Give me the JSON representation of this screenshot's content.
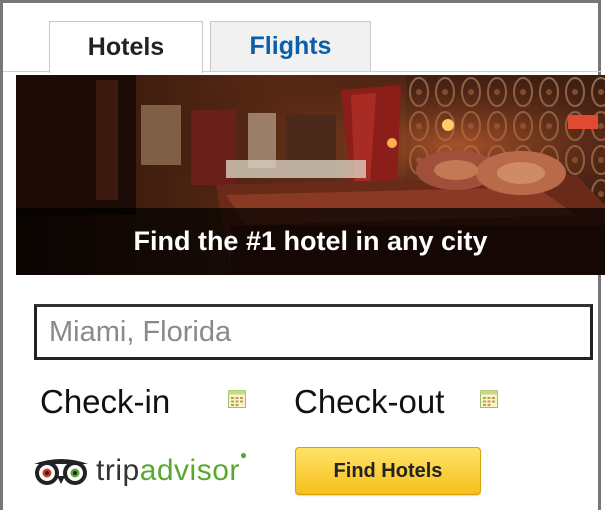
{
  "tabs": [
    {
      "label": "Hotels"
    },
    {
      "label": "Flights"
    }
  ],
  "banner": {
    "caption": "Find the #1 hotel in any city"
  },
  "search": {
    "placeholder": "Miami, Florida"
  },
  "dates": {
    "checkin_label": "Check-in",
    "checkout_label": "Check-out"
  },
  "brand": {
    "trip": "trip",
    "advisor": "advisor",
    "logo_icon": "tripadvisor-owl-eyes-icon",
    "green": "#5aa832"
  },
  "actions": {
    "find_label": "Find Hotels"
  },
  "colors": {
    "flights_tab_text": "#0b5ea8",
    "button_gold": "#f7bf1a"
  }
}
